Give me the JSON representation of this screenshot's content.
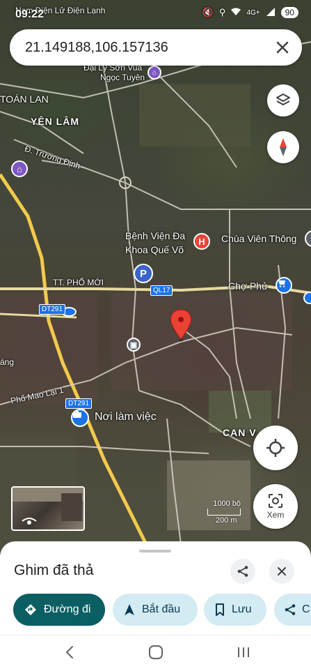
{
  "status_bar": {
    "time": "09:22",
    "network": "4G+",
    "battery": "90"
  },
  "search": {
    "value": "21.149188,106.157136"
  },
  "map": {
    "labels": {
      "top_notification": "Nam Điện Lử Điện Lạnh",
      "ngoc_tuyen_1": "Đại Lý Sơn Vua",
      "ngoc_tuyen_2": "Ngọc Tuyên",
      "toan_lan": "TOÁN LAN",
      "yen_lam": "YÊN LÂM",
      "truong_dinh": "Đ. Trương Định",
      "hospital_1": "Bệnh Viện Đa",
      "hospital_2": "Khoa Quế Võ",
      "chua": "Chùa Viên Thông",
      "pho_moi": "TT. PHỐ MỚI",
      "cho_phu": "Chợ Phủ",
      "pho_mao": "Phố Mao Lại 1",
      "ang": "áng",
      "workplace": "Nơi làm việc",
      "can_v": "CAN V",
      "shield_ql17": "QL17",
      "shield_dt291_a": "DT291",
      "shield_dt291_b": "DT291",
      "parking": "P",
      "hospital_pin": "H"
    },
    "scale": {
      "feet": "1000 bộ",
      "meters": "200 m"
    },
    "controls": {
      "view_label": "Xem"
    },
    "colors": {
      "accent_red": "#ea4335",
      "road_yellow": "#f2c94c",
      "shield_blue": "#1a73e8",
      "poi_purple": "#7e57c2"
    }
  },
  "sheet": {
    "title": "Ghim đã thả",
    "chips": [
      {
        "label": "Đường đi"
      },
      {
        "label": "Bắt đầu"
      },
      {
        "label": "Lưu"
      },
      {
        "label": "C"
      }
    ],
    "colors": {
      "primary": "#0b5f63",
      "secondary": "#d3ebf3"
    }
  },
  "nav": {
    "back": "back-icon",
    "home": "home-icon",
    "recents": "recents-icon"
  }
}
